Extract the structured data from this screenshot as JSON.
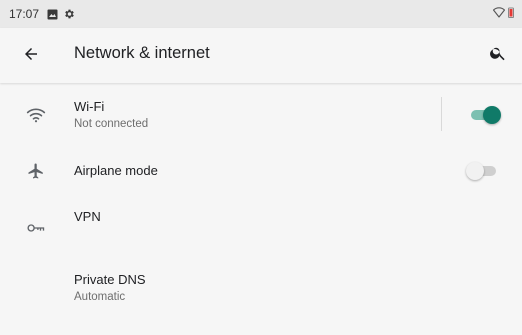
{
  "status_bar": {
    "time": "17:07",
    "icons": [
      "image-notification-icon",
      "gear-icon",
      "wifi-outline-icon",
      "battery-low-icon"
    ]
  },
  "app_bar": {
    "title": "Network & internet",
    "back_icon": "arrow-back-icon",
    "search_icon": "search-icon"
  },
  "settings": {
    "wifi": {
      "title": "Wi-Fi",
      "summary": "Not connected",
      "icon": "wifi-icon",
      "enabled": true
    },
    "airplane": {
      "title": "Airplane mode",
      "icon": "airplane-icon",
      "enabled": false
    },
    "vpn": {
      "title": "VPN",
      "icon": "key-icon"
    },
    "private_dns": {
      "title": "Private DNS",
      "summary": "Automatic"
    }
  },
  "colors": {
    "accent": "#107a68",
    "accent_track": "#7cc0b1",
    "battery_low": "#e53935"
  }
}
